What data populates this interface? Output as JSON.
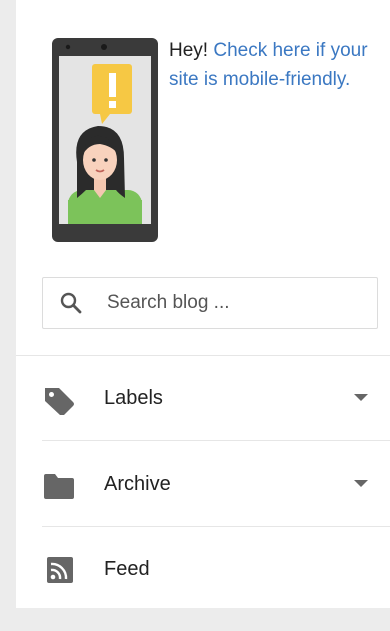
{
  "promo": {
    "greeting": "Hey! ",
    "link_text": "Check here if your site is mobile-friendly.",
    "illustration_icon": "phone-with-woman-and-alert-icon",
    "colors": {
      "phone": "#3a3a3a",
      "bubble": "#f6c844",
      "shirt": "#7cc35a",
      "link": "#3b78c2"
    }
  },
  "search": {
    "placeholder": "Search blog ...",
    "value": ""
  },
  "nav": {
    "items": [
      {
        "label": "Labels",
        "icon": "tag-icon",
        "expandable": true
      },
      {
        "label": "Archive",
        "icon": "folder-icon",
        "expandable": true
      },
      {
        "label": "Feed",
        "icon": "rss-feed-icon",
        "expandable": false
      }
    ]
  }
}
